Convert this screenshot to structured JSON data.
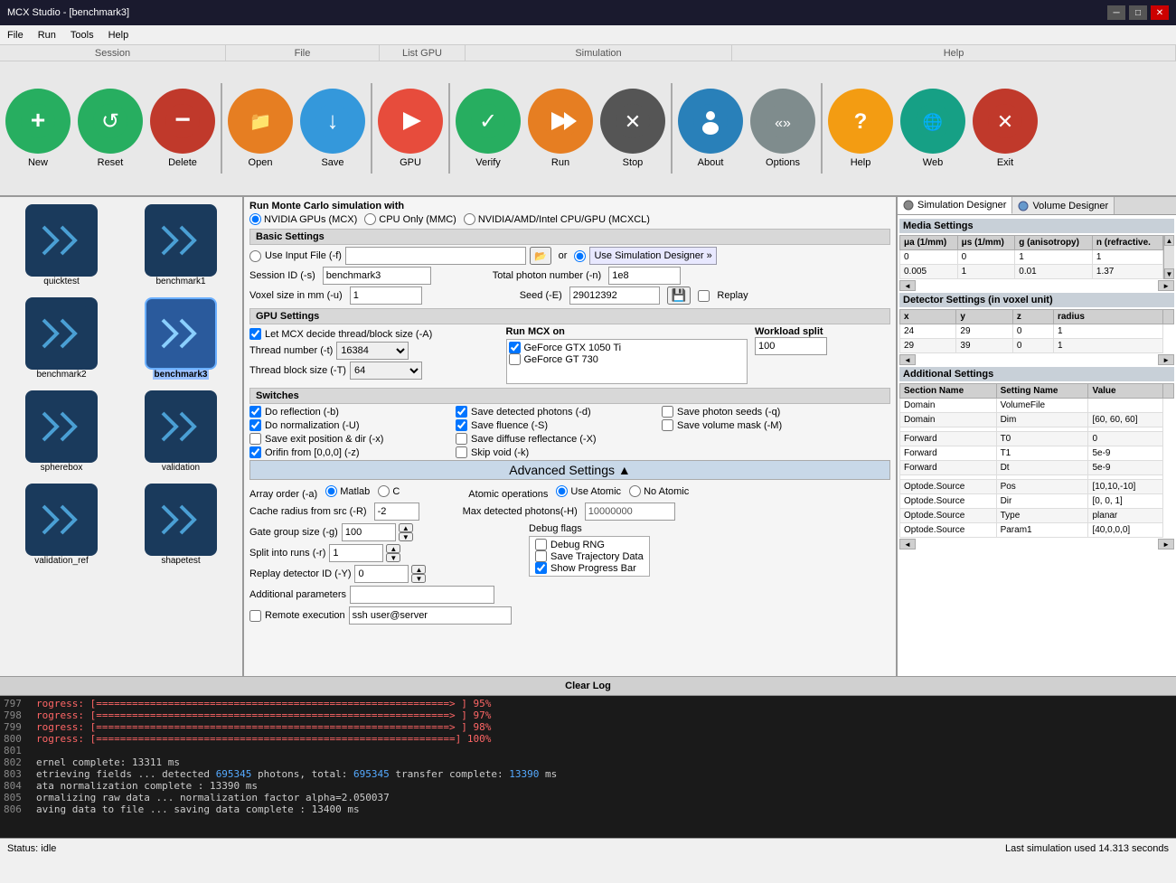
{
  "window": {
    "title": "MCX Studio - [benchmark3]",
    "controls": [
      "minimize",
      "maximize",
      "close"
    ]
  },
  "menubar": {
    "items": [
      "File",
      "Run",
      "Tools",
      "Help"
    ]
  },
  "toolbar": {
    "buttons": [
      {
        "id": "new",
        "label": "New",
        "color": "#2ecc71",
        "icon": "+",
        "section": "Session"
      },
      {
        "id": "reset",
        "label": "Reset",
        "color": "#27ae60",
        "icon": "↺"
      },
      {
        "id": "delete",
        "label": "Delete",
        "color": "#c0392b",
        "icon": "−"
      },
      {
        "id": "open",
        "label": "Open",
        "color": "#e67e22",
        "icon": "📁",
        "section": "File"
      },
      {
        "id": "save",
        "label": "Save",
        "color": "#3498db",
        "icon": "↓"
      },
      {
        "id": "gpu",
        "label": "GPU",
        "color": "#e74c3c",
        "icon": "▶",
        "section": "List GPU"
      },
      {
        "id": "verify",
        "label": "Verify",
        "color": "#27ae60",
        "icon": "✓",
        "section": "Simulation"
      },
      {
        "id": "run",
        "label": "Run",
        "color": "#e67e22",
        "icon": "▶▶"
      },
      {
        "id": "stop",
        "label": "Stop",
        "color": "#555555",
        "icon": "✕"
      },
      {
        "id": "about",
        "label": "About",
        "color": "#2980b9",
        "icon": "👤",
        "section": ""
      },
      {
        "id": "options",
        "label": "Options",
        "color": "#7f8c8d",
        "icon": "«»"
      },
      {
        "id": "help",
        "label": "Help",
        "color": "#f39c12",
        "icon": "?",
        "section": "Help"
      },
      {
        "id": "web",
        "label": "Web",
        "color": "#16a085",
        "icon": "🌐"
      },
      {
        "id": "exit",
        "label": "Exit",
        "color": "#c0392b",
        "icon": "✕"
      }
    ]
  },
  "session": {
    "label": "Session",
    "items": [
      {
        "id": "quicktest",
        "label": "quicktest",
        "selected": false
      },
      {
        "id": "benchmark1",
        "label": "benchmark1",
        "selected": false
      },
      {
        "id": "benchmark2",
        "label": "benchmark2",
        "selected": false
      },
      {
        "id": "benchmark3",
        "label": "benchmark3",
        "selected": true
      },
      {
        "id": "spherebox",
        "label": "spherebox",
        "selected": false
      },
      {
        "id": "validation",
        "label": "validation",
        "selected": false
      },
      {
        "id": "validation_ref",
        "label": "validation_ref",
        "selected": false
      },
      {
        "id": "shapetest",
        "label": "shapetest",
        "selected": false
      },
      {
        "id": "item9",
        "label": "",
        "selected": false
      },
      {
        "id": "item10",
        "label": "",
        "selected": false
      }
    ]
  },
  "simulation": {
    "title": "Run Monte Carlo simulation with",
    "gpu_option": "NVIDIA GPUs (MCX)",
    "cpu_option": "CPU Only (MMC)",
    "amd_option": "NVIDIA/AMD/Intel CPU/GPU (MCXCL)",
    "basic_settings": "Basic Settings",
    "use_input_file_label": "Use Input File (-f)",
    "use_simulation_designer_label": "Use Simulation Designer »",
    "session_id_label": "Session ID (-s)",
    "session_id_value": "benchmark3",
    "total_photon_label": "Total photon number (-n)",
    "total_photon_value": "1e8",
    "voxel_size_label": "Voxel size in mm (-u)",
    "voxel_size_value": "1",
    "seed_label": "Seed (-E)",
    "seed_value": "29012392",
    "replay_label": "Replay",
    "gpu_settings": "GPU Settings",
    "let_mcx_label": "Let MCX decide thread/block size (-A)",
    "run_mcx_on_label": "Run MCX on",
    "workload_split_label": "Workload split",
    "workload_value": "100",
    "thread_number_label": "Thread number (-t)",
    "thread_number_value": "16384",
    "thread_block_label": "Thread block size (-T)",
    "thread_block_value": "64",
    "gpu1": "GeForce GTX 1050 Ti",
    "gpu2": "GeForce GT 730",
    "switches": "Switches",
    "sw1": "Do reflection (-b)",
    "sw2": "Do normalization (-U)",
    "sw3": "Save exit position & dir (-x)",
    "sw4": "Orifin from [0,0,0] (-z)",
    "sw5": "Save detected photons (-d)",
    "sw6": "Save fluence (-S)",
    "sw7": "Save diffuse reflectance (-X)",
    "sw8": "Skip void (-k)",
    "sw9": "Save photon seeds (-q)",
    "sw10": "Save volume mask (-M)",
    "sw1_checked": true,
    "sw2_checked": true,
    "sw3_checked": false,
    "sw4_checked": true,
    "sw5_checked": true,
    "sw6_checked": true,
    "sw7_checked": false,
    "sw8_checked": false,
    "sw9_checked": false,
    "sw10_checked": false,
    "advanced_settings": "Advanced Settings",
    "array_order_label": "Array order (-a)",
    "array_matlab": "Matlab",
    "array_c": "C",
    "atomic_ops_label": "Atomic operations",
    "use_atomic": "Use Atomic",
    "no_atomic": "No Atomic",
    "cache_radius_label": "Cache radius from src (-R)",
    "cache_radius_value": "-2",
    "max_detected_label": "Max detected photons(-H)",
    "max_detected_value": "10000000",
    "gate_group_label": "Gate group size (-g)",
    "gate_group_value": "100",
    "debug_flags_label": "Debug flags",
    "debug_rng": "Debug RNG",
    "save_trajectory": "Save Trajectory Data",
    "show_progress": "Show Progress Bar",
    "split_runs_label": "Split into runs (-r)",
    "split_runs_value": "1",
    "replay_det_label": "Replay detector ID (-Y)",
    "replay_det_value": "0",
    "additional_params_label": "Additional parameters",
    "additional_params_value": "",
    "remote_exec_label": "Remote execution",
    "remote_exec_value": "ssh user@server"
  },
  "right_panel": {
    "tab1": "Simulation Designer",
    "tab2": "Volume Designer",
    "media_settings": "Media Settings",
    "media_headers": [
      "μa (1/mm)",
      "μs (1/mm)",
      "g (anisotropy)",
      "n (refractive."
    ],
    "media_rows": [
      [
        "0",
        "0",
        "1",
        "1"
      ],
      [
        "0.005",
        "1",
        "0.01",
        "1.37"
      ]
    ],
    "detector_settings": "Detector Settings (in voxel unit)",
    "detector_headers": [
      "x",
      "y",
      "z",
      "radius"
    ],
    "detector_rows": [
      [
        "24",
        "29",
        "0",
        "1"
      ],
      [
        "29",
        "39",
        "0",
        "1"
      ]
    ],
    "additional_settings": "Additional Settings",
    "additional_headers": [
      "Section Name",
      "Setting Name",
      "Value"
    ],
    "additional_rows": [
      [
        "Domain",
        "VolumeFile",
        ""
      ],
      [
        "Domain",
        "Dim",
        "[60, 60, 60]"
      ],
      [
        "",
        "",
        ""
      ],
      [
        "Forward",
        "T0",
        "0"
      ],
      [
        "Forward",
        "T1",
        "5e-9"
      ],
      [
        "Forward",
        "Dt",
        "5e-9"
      ],
      [
        "",
        "",
        ""
      ],
      [
        "Optode.Source",
        "Pos",
        "[10,10,-10]"
      ],
      [
        "Optode.Source",
        "Dir",
        "[0, 0, 1]"
      ],
      [
        "Optode.Source",
        "Type",
        "planar"
      ],
      [
        "Optode.Source",
        "Param1",
        "[40,0,0,0]"
      ]
    ]
  },
  "log": {
    "clear_label": "Clear Log",
    "lines": [
      {
        "num": "797",
        "text": "rogress: [===========================================================>  ]  95%",
        "type": "progress"
      },
      {
        "num": "798",
        "text": "rogress: [===========================================================>  ]  97%",
        "type": "progress"
      },
      {
        "num": "799",
        "text": "rogress: [===========================================================>  ]  98%",
        "type": "progress"
      },
      {
        "num": "800",
        "text": "rogress: [============================================================] 100%",
        "type": "progress"
      },
      {
        "num": "801",
        "text": "",
        "type": "normal"
      },
      {
        "num": "802",
        "text": "ernel complete:          13311 ms",
        "type": "normal"
      },
      {
        "num": "803",
        "text": "etrieving fields ...    detected 695345 photons, total: 695345   transfer complete:      13390 ms",
        "type": "mixed"
      },
      {
        "num": "804",
        "text": "ata normalization complete : 13390 ms",
        "type": "normal"
      },
      {
        "num": "805",
        "text": "ormalizing raw data ...    normalization factor alpha=2.050037",
        "type": "normal"
      },
      {
        "num": "806",
        "text": "aving data to file ...              saving data complete : 13400 ms",
        "type": "normal"
      }
    ]
  },
  "statusbar": {
    "left": "Status: idle",
    "right": "Last simulation used 14.313 seconds"
  }
}
